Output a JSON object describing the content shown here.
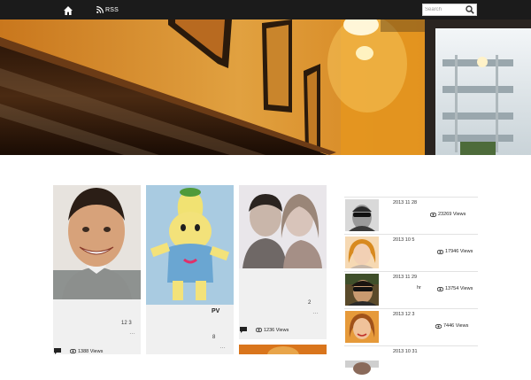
{
  "nav": {
    "home_icon": "home-icon",
    "rss_label": "RSS",
    "rss_icon": "rss-icon",
    "search_placeholder": "Search",
    "search_icon": "search-icon"
  },
  "hero": {
    "description_icon": "banner-photo"
  },
  "cards": [
    {
      "meta": "12 3",
      "more": "…",
      "views": "1388 Views"
    },
    {
      "title": "PV",
      "meta": "8",
      "more": "…"
    },
    {
      "meta": "2",
      "more": "…",
      "views": "1236 Views"
    }
  ],
  "sidebar": [
    {
      "date": "2013 11 28",
      "views": "23269 Views"
    },
    {
      "date": "2013 10 5",
      "views": "17946 Views"
    },
    {
      "date": "2013 11 29",
      "extra": "hr",
      "views": "13754 Views"
    },
    {
      "date": "2013 12 3",
      "views": "7446 Views"
    },
    {
      "date": "2013 10 31"
    }
  ],
  "colors": {
    "topbar": "#1b1b1b",
    "card_bg": "#f0f0f0"
  }
}
